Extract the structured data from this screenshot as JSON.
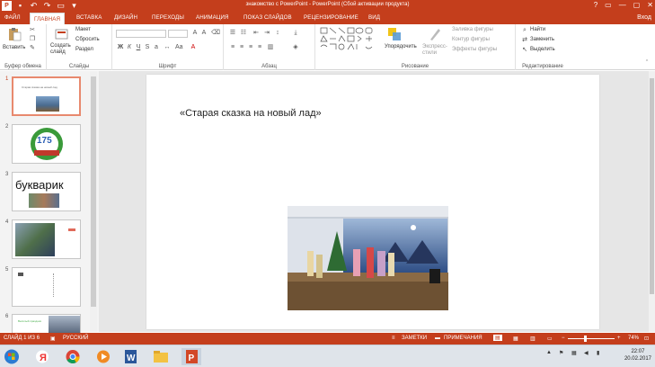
{
  "window": {
    "title": "знакомство с PowerPoint - PowerPoint (Сбой активации продукта)",
    "controls": [
      "?",
      "▭",
      "—",
      "▢",
      "✕"
    ],
    "signin": "Вход"
  },
  "tabs": [
    {
      "label": "ФАЙЛ"
    },
    {
      "label": "ГЛАВНАЯ"
    },
    {
      "label": "ВСТАВКА"
    },
    {
      "label": "ДИЗАЙН"
    },
    {
      "label": "ПЕРЕХОДЫ"
    },
    {
      "label": "АНИМАЦИЯ"
    },
    {
      "label": "ПОКАЗ СЛАЙДОВ"
    },
    {
      "label": "РЕЦЕНЗИРОВАНИЕ"
    },
    {
      "label": "ВИД"
    }
  ],
  "ribbon": {
    "clipboard": {
      "group": "Буфер обмена",
      "paste": "Вставить"
    },
    "slides": {
      "group": "Слайды",
      "new_slide": "Создать слайд",
      "layout": "Макет",
      "reset": "Сбросить",
      "section": "Раздел"
    },
    "font": {
      "group": "Шрифт"
    },
    "paragraph": {
      "group": "Абзац"
    },
    "drawing": {
      "group": "Рисование",
      "arrange": "Упорядочить",
      "quick_styles": "Экспресс-стили",
      "fill": "Заливка фигуры",
      "outline": "Контур фигуры",
      "effects": "Эффекты фигуры"
    },
    "editing": {
      "group": "Редактирование",
      "find": "Найти",
      "replace": "Заменить",
      "select": "Выделить"
    }
  },
  "slides_pane": [
    {
      "number": "1",
      "caption": "Старая сказка на новый лад"
    },
    {
      "number": "2",
      "caption": "175"
    },
    {
      "number": "3",
      "caption": "букварик"
    },
    {
      "number": "4",
      "caption": ""
    },
    {
      "number": "5",
      "caption": ""
    },
    {
      "number": "6",
      "caption": "Весёлый праздник"
    }
  ],
  "slide": {
    "title": "«Старая сказка на новый лад»"
  },
  "status": {
    "slide_info": "СЛАЙД 1 ИЗ 6",
    "language": "РУССКИЙ",
    "notes": "ЗАМЕТКИ",
    "comments": "ПРИМЕЧАНИЯ",
    "zoom": "74%"
  },
  "taskbar": {
    "time": "22:07",
    "date": "20.02.2017"
  },
  "colors": {
    "accent": "#c43e1c",
    "pane": "#f3f3f3",
    "editor_bg": "#e6e6e6"
  }
}
